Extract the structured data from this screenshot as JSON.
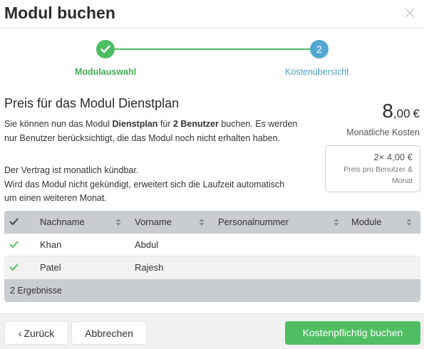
{
  "dialog": {
    "title": "Modul buchen"
  },
  "stepper": {
    "step1_label": "Modulauswahl",
    "step2_number": "2",
    "step2_label": "Kostenübersicht"
  },
  "content": {
    "heading": "Preis für das Modul Dienstplan",
    "p1_a": "Sie können nun das Modul ",
    "p1_module": "Dienstplan",
    "p1_b": " für ",
    "p1_users": "2 Benutzer",
    "p1_c": " buchen. Es werden nur Benutzer berücksichtigt, die das Modul noch nicht erhalten haben.",
    "p2_line1": "Der Vertrag ist monatlich kündbar.",
    "p2_line2": "Wird das Modul nicht gekündigt, erweitert sich die Laufzeit automatisch",
    "p2_line3": "um einen weiteren Monat."
  },
  "price": {
    "integer": "8",
    "decimal": ",00",
    "currency": "€",
    "label": "Monatliche Kosten",
    "per_user": "2× 4,00 €",
    "per_user_line1": "Preis pro Benutzer &",
    "per_user_line2": "Monat"
  },
  "table": {
    "columns": [
      "Nachname",
      "Vorname",
      "Personalnummer",
      "Module"
    ],
    "rows": [
      {
        "nachname": "Khan",
        "vorname": "Abdul",
        "personalnummer": "",
        "module": ""
      },
      {
        "nachname": "Patel",
        "vorname": "Rajesh",
        "personalnummer": "",
        "module": ""
      }
    ],
    "footer": "2 Ergebnisse"
  },
  "footer": {
    "back_label": "Zurück",
    "cancel_label": "Abbrechen",
    "book_label": "Kostenpflichtig buchen"
  },
  "colors": {
    "accent_green": "#4fbe62",
    "accent_blue": "#53a6cf",
    "table_header": "#c9ccd1"
  },
  "icons": {
    "close": "close-icon",
    "check": "check-icon",
    "sort": "sort-icon",
    "back": "chevron-left-icon"
  }
}
